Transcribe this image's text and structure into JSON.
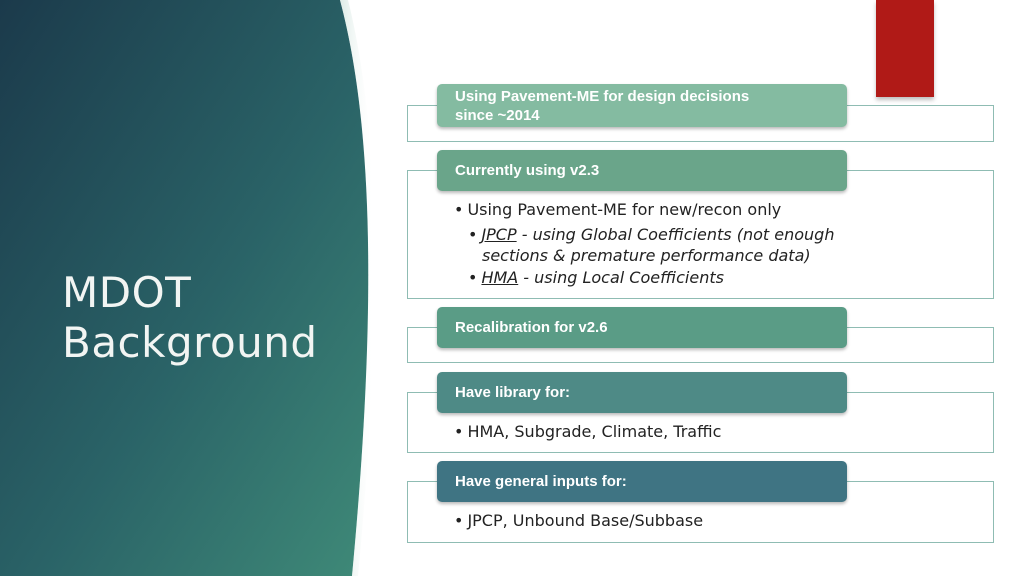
{
  "colors": {
    "panel_dark": "#1d3f4e",
    "panel_light": "#3f8a78",
    "accent": "#b01a17",
    "header_1": "#84bba1",
    "header_2": "#6aa58a",
    "header_3": "#5a9c86",
    "header_4": "#4e8a86",
    "header_5": "#3f7483"
  },
  "title": {
    "line1": "MDOT",
    "line2": "Background"
  },
  "sections": [
    {
      "heading_line1": "Using Pavement-ME for design decisions",
      "heading_line2": "since ~2014"
    },
    {
      "heading": "Currently using v2.3",
      "bullet": "Using Pavement-ME for new/recon only",
      "sub1_term": "JPCP",
      "sub1_rest_line1": " - using Global Coefficients (not enough",
      "sub1_rest_line2": "sections & premature performance data)",
      "sub2_term": "HMA",
      "sub2_rest": " - using Local Coefficients"
    },
    {
      "heading": "Recalibration for v2.6"
    },
    {
      "heading": "Have library for:",
      "bullet": "HMA, Subgrade, Climate, Traffic"
    },
    {
      "heading": "Have general inputs for:",
      "bullet": "JPCP, Unbound Base/Subbase"
    }
  ],
  "icons": {
    "bullet": "•"
  }
}
